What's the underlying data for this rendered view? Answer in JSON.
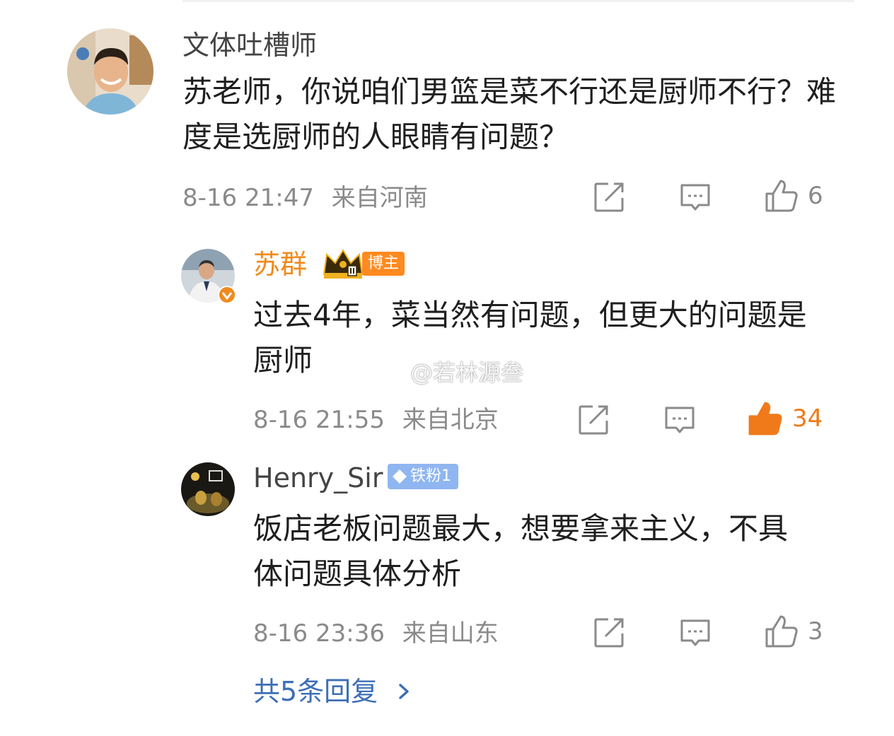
{
  "comments": [
    {
      "username": "文体吐槽师",
      "text": "苏老师，你说咱们男篮是菜不行还是厨师不行？难度是选厨师的人眼睛有问题？",
      "date": "8-16 21:47",
      "location": "来自河南",
      "likes": "6"
    },
    {
      "username": "苏群",
      "badge": "博主",
      "text": "过去4年，菜当然有问题，但更大的问题是厨师",
      "date": "8-16 21:55",
      "location": "来自北京",
      "likes": "34"
    },
    {
      "username": "Henry_Sir",
      "badge": "铁粉1",
      "text": "饭店老板问题最大，想要拿来主义，不具体问题具体分析",
      "date": "8-16 23:36",
      "location": "来自山东",
      "likes": "3"
    }
  ],
  "more_replies": "共5条回复",
  "watermark": "@若林源叁",
  "colors": {
    "accent_orange": "#f08a1e",
    "link_blue": "#3d6fb6",
    "meta_gray": "#8a8a8a",
    "liked": "#f07a1a"
  },
  "icons": [
    "share-icon",
    "comment-icon",
    "like-icon",
    "crown-icon",
    "verified-icon",
    "diamond-icon",
    "weibo-logo-icon",
    "chevron-right-icon"
  ]
}
